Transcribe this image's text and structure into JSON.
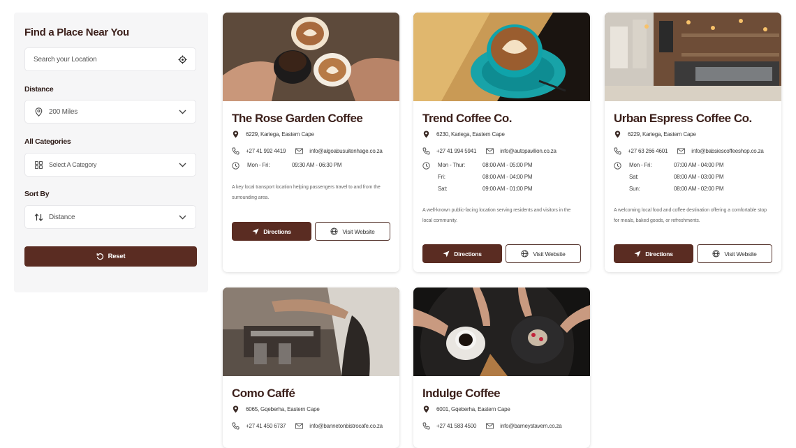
{
  "sidebar": {
    "title": "Find a Place Near You",
    "search": {
      "placeholder": "Search your Location",
      "icon": "crosshair-icon"
    },
    "distance": {
      "label": "Distance",
      "value": "200 Miles"
    },
    "categories": {
      "label": "All Categories",
      "value": "Select A Category"
    },
    "sort": {
      "label": "Sort By",
      "value": "Distance"
    },
    "reset_label": "Reset"
  },
  "colors": {
    "brand": "#5a2c22",
    "sidebar_bg": "#f6f6f7",
    "heading": "#3b1f1a"
  },
  "cards": [
    {
      "name": "The Rose Garden Coffee",
      "address": "6229, Kariega, Eastern Cape",
      "phone": "+27 41 992 4419",
      "email": "info@algoabusuitenhage.co.za",
      "hours": [
        {
          "day": "Mon - Fri:",
          "time": "09:30 AM - 06:30 PM"
        }
      ],
      "description": "A key local transport location helping passengers travel to and from the surrounding area.",
      "directions_label": "Directions",
      "website_label": "Visit Website"
    },
    {
      "name": "Trend Coffee Co.",
      "address": "6230, Kariega, Eastern Cape",
      "phone": "+27 41 994 5941",
      "email": "info@autopavilion.co.za",
      "hours": [
        {
          "day": "Mon - Thur:",
          "time": "08:00 AM - 05:00 PM"
        },
        {
          "day": "Fri:",
          "time": "08:00 AM - 04:00 PM"
        },
        {
          "day": "Sat:",
          "time": "09:00 AM - 01:00 PM"
        }
      ],
      "description": "A well-known public-facing location serving residents and visitors in the local community.",
      "directions_label": "Directions",
      "website_label": "Visit Website"
    },
    {
      "name": "Urban Espress Coffee Co.",
      "address": "6229, Kariega, Eastern Cape",
      "phone": "+27 63 266 4601",
      "email": "info@babsiescoffeeshop.co.za",
      "hours": [
        {
          "day": "Mon - Fri:",
          "time": "07:00 AM - 04:00 PM"
        },
        {
          "day": "Sat:",
          "time": "08:00 AM - 03:00 PM"
        },
        {
          "day": "Sun:",
          "time": "08:00 AM - 02:00 PM"
        }
      ],
      "description": "A welcoming local food and coffee destination offering a comfortable stop for meals, baked goods, or refreshments.",
      "directions_label": "Directions",
      "website_label": "Visit Website"
    },
    {
      "name": "Como Caffé",
      "address": "6065, Gqeberha, Eastern Cape",
      "phone": "+27 41 450 6737",
      "email": "info@bannetonbistrocafe.co.za"
    },
    {
      "name": "Indulge Coffee",
      "address": "6001, Gqeberha, Eastern Cape",
      "phone": "+27 41 583 4500",
      "email": "info@barneystavern.co.za"
    }
  ]
}
